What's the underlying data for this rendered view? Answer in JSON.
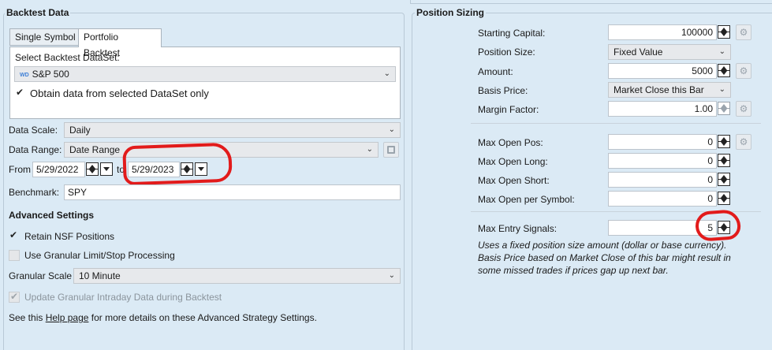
{
  "left_panel": {
    "title": "Backtest Data",
    "tabs": [
      {
        "label": "Single Symbol",
        "active": false
      },
      {
        "label": "Portfolio Backtest",
        "active": true
      }
    ],
    "dataset_label": "Select Backtest DataSet:",
    "dataset_badge": "WD",
    "dataset_value": "S&P 500",
    "obtain_data_label": "Obtain data from selected DataSet only",
    "obtain_data_checked": true,
    "data_scale_label": "Data Scale:",
    "data_scale_value": "Daily",
    "data_range_label": "Data Range:",
    "data_range_value": "Date Range",
    "from_label": "From",
    "from_date": "5/29/2022",
    "to_label": "to",
    "to_date": "5/29/2023",
    "benchmark_label": "Benchmark:",
    "benchmark_value": "SPY",
    "advanced_title": "Advanced Settings",
    "retain_nsf_label": "Retain NSF Positions",
    "retain_nsf_checked": true,
    "granular_processing_label": "Use Granular Limit/Stop Processing",
    "granular_processing_checked": false,
    "granular_scale_label": "Granular Scale",
    "granular_scale_value": "10 Minute",
    "update_granular_label": "Update Granular Intraday Data during Backtest",
    "help_prefix": "See this ",
    "help_link": "Help page",
    "help_suffix": " for more details on these Advanced Strategy Settings."
  },
  "right_panel": {
    "title": "Position Sizing",
    "starting_capital_label": "Starting Capital:",
    "starting_capital_value": "100000",
    "position_size_label": "Position Size:",
    "position_size_value": "Fixed Value",
    "amount_label": "Amount:",
    "amount_value": "5000",
    "basis_price_label": "Basis Price:",
    "basis_price_value": "Market Close this Bar",
    "margin_factor_label": "Margin Factor:",
    "margin_factor_value": "1.00",
    "max_open_pos_label": "Max Open Pos:",
    "max_open_pos_value": "0",
    "max_open_long_label": "Max Open Long:",
    "max_open_long_value": "0",
    "max_open_short_label": "Max Open Short:",
    "max_open_short_value": "0",
    "max_open_per_symbol_label": "Max Open per Symbol:",
    "max_open_per_symbol_value": "0",
    "max_entry_signals_label": "Max Entry Signals:",
    "max_entry_signals_value": "5",
    "description": "Uses a fixed position size amount (dollar or base currency). Basis Price based on Market Close of this bar might result in some missed trades if prices gap up next bar."
  },
  "colors": {
    "background": "#dbeaf5",
    "annotation_red": "#e21b1b"
  }
}
